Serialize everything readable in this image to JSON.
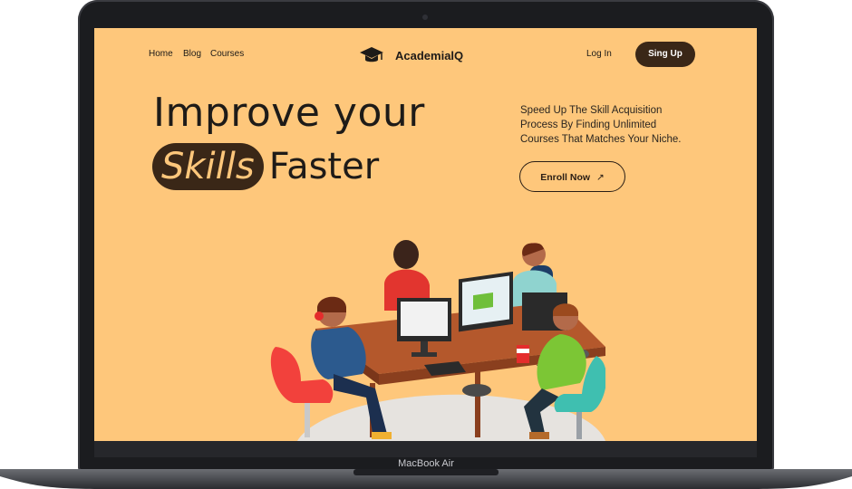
{
  "nav": {
    "links": [
      "Home",
      "Blog",
      "Courses"
    ],
    "brand": "AcademialQ",
    "login": "Log In",
    "signup": "Sing Up"
  },
  "hero": {
    "line1": "Improve your",
    "highlight": "Skills",
    "line2_rest": "Faster",
    "description": [
      "Speed Up The Skill Acquisition",
      "Process By Finding Unlimited",
      "Courses That Matches Your Niche."
    ],
    "cta": "Enroll Now",
    "cta_icon": "arrow-up-right-icon"
  },
  "device": {
    "label": "MacBook Air"
  },
  "colors": {
    "background": "#fec77b",
    "accent_dark": "#3a2717",
    "text": "#1e1b18"
  }
}
